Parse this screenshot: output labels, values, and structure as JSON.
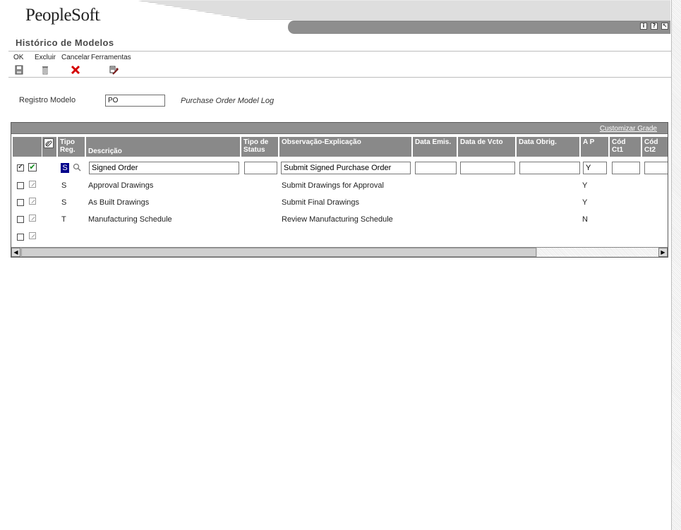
{
  "app": {
    "logo": "PeopleSoft",
    "logo_mark": "."
  },
  "header_icons": [
    {
      "name": "info-icon",
      "glyph": "i"
    },
    {
      "name": "help-icon",
      "glyph": "?"
    },
    {
      "name": "exit-icon",
      "glyph": "↖"
    }
  ],
  "page_title": "Histórico de Modelos",
  "toolbar": {
    "ok": "OK",
    "delete": "Excluir",
    "cancel": "Cancelar",
    "tools": "Ferramentas"
  },
  "record": {
    "label": "Registro Modelo",
    "value": "PO",
    "description": "Purchase Order Model Log"
  },
  "grid": {
    "customize_link": "Customizar Grade",
    "headers": {
      "tipo_reg": "Tipo Reg.",
      "descricao": "Descrição",
      "tipo_status": "Tipo de Status",
      "observacao": "Observação-Explicação",
      "data_emis": "Data Emis.",
      "data_vcto": "Data de Vcto",
      "data_obrig": "Data Obrig.",
      "ap": "A P",
      "cod_ct1": "Cód Ct1",
      "cod_ct2": "Cód Ct2"
    },
    "rows": [
      {
        "tipo": "S",
        "descricao": "Signed Order",
        "observacao": "Submit Signed Purchase Order",
        "ap": "Y"
      },
      {
        "tipo": "S",
        "descricao": "Approval Drawings",
        "observacao": "Submit Drawings for Approval",
        "ap": "Y"
      },
      {
        "tipo": "S",
        "descricao": "As Built Drawings",
        "observacao": "Submit Final Drawings",
        "ap": "Y"
      },
      {
        "tipo": "T",
        "descricao": "Manufacturing Schedule",
        "observacao": "Review Manufacturing Schedule",
        "ap": "N"
      }
    ]
  },
  "colors": {
    "header_gray": "#898989",
    "cancel_red": "#d40000",
    "check_green": "#0a8a1a"
  }
}
